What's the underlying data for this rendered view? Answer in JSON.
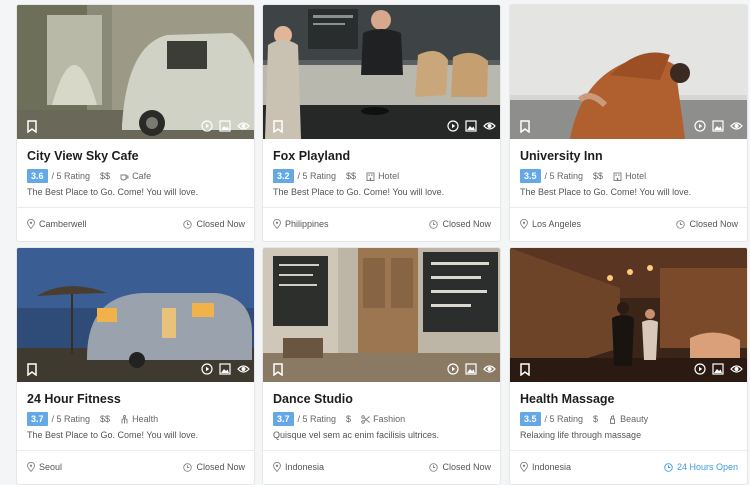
{
  "listings": [
    {
      "title": "City View Sky Cafe",
      "rating": "3.6",
      "rating_suffix": "/ 5 Rating",
      "price": "$$",
      "category": "Cafe",
      "category_icon": "coffee-cup-icon",
      "description": "The Best Place to Go. Come! You will love.",
      "location": "Camberwell",
      "status": "Closed Now"
    },
    {
      "title": "Fox Playland",
      "rating": "3.2",
      "rating_suffix": "/ 5 Rating",
      "price": "$$",
      "category": "Hotel",
      "category_icon": "hotel-icon",
      "description": "The Best Place to Go. Come! You will love.",
      "location": "Philippines",
      "status": "Closed Now"
    },
    {
      "title": "University Inn",
      "rating": "3.5",
      "rating_suffix": "/ 5 Rating",
      "price": "$$",
      "category": "Hotel",
      "category_icon": "hotel-icon",
      "description": "The Best Place to Go. Come! You will love.",
      "location": "Los Angeles",
      "status": "Closed Now"
    },
    {
      "title": "24 Hour Fitness",
      "rating": "3.7",
      "rating_suffix": "/ 5 Rating",
      "price": "$$",
      "category": "Health",
      "category_icon": "health-icon",
      "description": "The Best Place to Go. Come! You will love.",
      "location": "Seoul",
      "status": "Closed Now"
    },
    {
      "title": "Dance Studio",
      "rating": "3.7",
      "rating_suffix": "/ 5 Rating",
      "price": "$",
      "category": "Fashion",
      "category_icon": "scissors-icon",
      "description": "Quisque vel sem ac enim facilisis ultrices.",
      "location": "Indonesia",
      "status": "Closed Now"
    },
    {
      "title": "Health Massage",
      "rating": "3.5",
      "rating_suffix": "/ 5 Rating",
      "price": "$",
      "category": "Beauty",
      "category_icon": "beauty-icon",
      "description": "Relaxing life through massage",
      "location": "Indonesia",
      "status": "24 Hours Open"
    }
  ],
  "colors": {
    "rating_badge": "#64a8e6",
    "open_status": "#3d9be0",
    "closed_status": "#555555"
  }
}
